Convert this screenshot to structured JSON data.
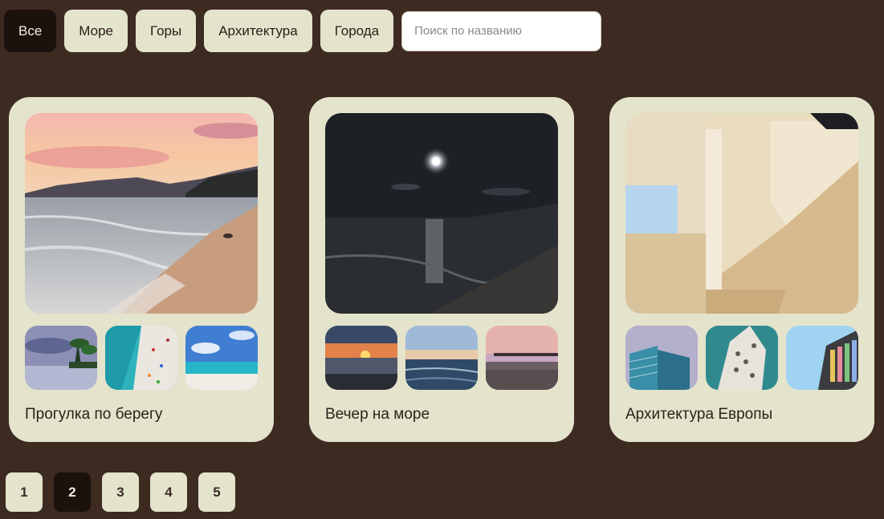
{
  "filters": [
    {
      "label": "Все",
      "active": true
    },
    {
      "label": "Море",
      "active": false
    },
    {
      "label": "Горы",
      "active": false
    },
    {
      "label": "Архитектура",
      "active": false
    },
    {
      "label": "Города",
      "active": false
    }
  ],
  "search": {
    "placeholder": "Поиск по названию",
    "value": ""
  },
  "cards": [
    {
      "title": "Прогулка по берегу"
    },
    {
      "title": "Вечер на море"
    },
    {
      "title": "Архитектура Европы"
    }
  ],
  "pagination": {
    "pages": [
      "1",
      "2",
      "3",
      "4",
      "5"
    ],
    "current": "2"
  },
  "colors": {
    "background": "#3d2a21",
    "card": "#e4e3cc",
    "active": "#1c120d"
  }
}
